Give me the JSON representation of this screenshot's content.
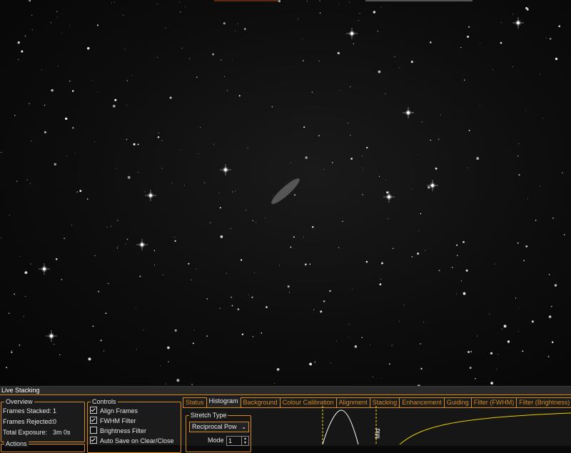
{
  "window": {
    "panel_title": "Live Stacking"
  },
  "overview": {
    "group_label": "Overview",
    "frames_stacked_label": "Frames Stacked:",
    "frames_stacked_value": "1",
    "frames_rejected_label": "Frames Rejected:",
    "frames_rejected_value": "0",
    "total_exposure_label": "Total Exposure:",
    "total_exposure_value": "3m 0s"
  },
  "actions": {
    "group_label": "Actions"
  },
  "controls": {
    "group_label": "Controls",
    "items": [
      {
        "label": "Align Frames",
        "checked": true
      },
      {
        "label": "FWHM Filter",
        "checked": true
      },
      {
        "label": "Brightness Filter",
        "checked": false
      },
      {
        "label": "Auto Save on Clear/Close",
        "checked": true
      }
    ]
  },
  "tabs": [
    {
      "label": "Status",
      "active": false
    },
    {
      "label": "Histogram",
      "active": true
    },
    {
      "label": "Background",
      "active": false
    },
    {
      "label": "Colour Calibration",
      "active": false
    },
    {
      "label": "Alignment",
      "active": false
    },
    {
      "label": "Stacking",
      "active": false
    },
    {
      "label": "Enhancement",
      "active": false
    },
    {
      "label": "Guiding",
      "active": false
    },
    {
      "label": "Filter (FWHM)",
      "active": false
    },
    {
      "label": "Filter (Brightness)",
      "active": false
    }
  ],
  "stretch": {
    "group_label": "Stretch Type",
    "selected": "Reciprocal Pow",
    "mode_label": "Mode",
    "mode_value": "1"
  },
  "histogram": {
    "mid_label": "Mid"
  },
  "colors": {
    "accent": "#d88a1a",
    "panel_bg": "#1b1b1b",
    "curve": "#e8d000",
    "marker": "#f0e000"
  }
}
